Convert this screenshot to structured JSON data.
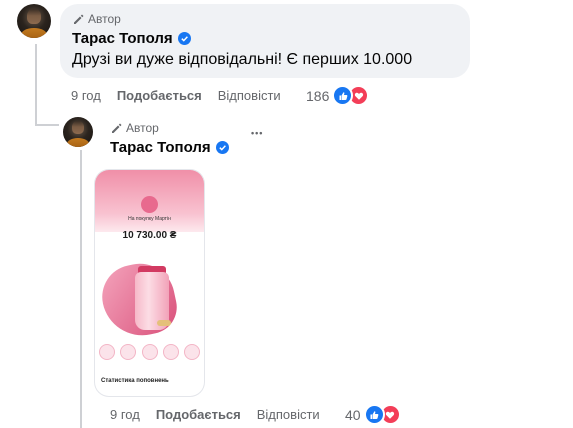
{
  "comment": {
    "author_badge": "Автор",
    "author_name": "Тарас Тополя",
    "text": "Друзі ви дуже відповідальні! Є перших 10.000",
    "time": "9 год",
    "like_label": "Подобається",
    "reply_label": "Відповісти",
    "reaction_count": "186"
  },
  "reply": {
    "author_badge": "Автор",
    "author_name": "Тарас Тополя",
    "more_label": "•••",
    "image": {
      "label": "На покупку Мартін",
      "amount": "10 730.00 ₴",
      "stats_label": "Статистика поповнень"
    },
    "time": "9 год",
    "like_label": "Подобається",
    "reply_label": "Відповісти",
    "reaction_count": "40"
  },
  "colors": {
    "verified": "#1877f2",
    "like_reaction": "#1877f2",
    "love_reaction": "#f33e58",
    "bubble_bg": "#f0f2f5",
    "secondary_text": "#65676b"
  },
  "icons": {
    "author_badge": "pencil-icon",
    "verified": "verified-badge-icon",
    "like_reaction": "thumbs-up-icon",
    "love_reaction": "heart-icon"
  }
}
